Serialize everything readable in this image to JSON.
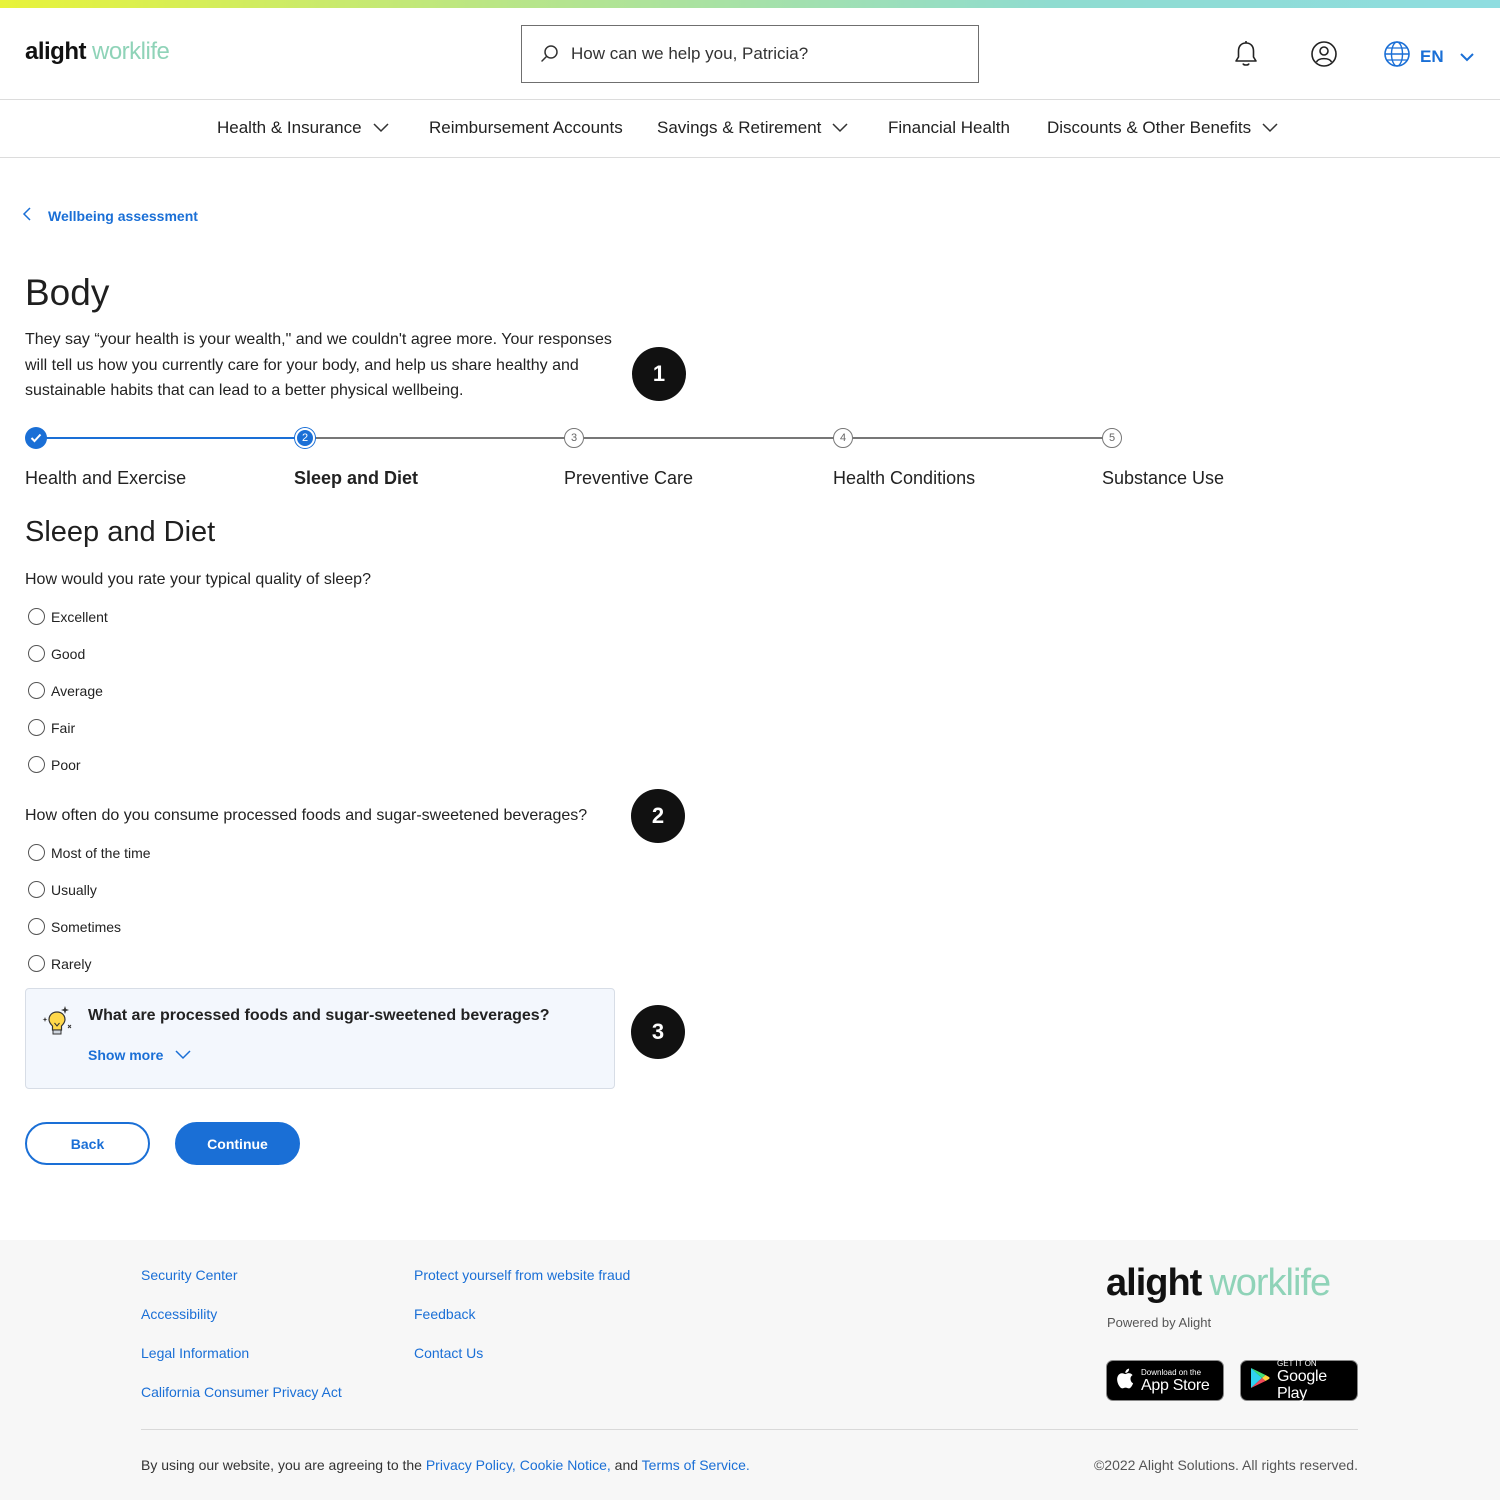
{
  "brand": {
    "logo_main": "alight",
    "logo_accent": "worklife"
  },
  "header": {
    "search_placeholder": "How can we help you, Patricia?",
    "language": "EN"
  },
  "nav": {
    "items": [
      {
        "label": "Health & Insurance",
        "has_dropdown": true
      },
      {
        "label": "Reimbursement Accounts",
        "has_dropdown": false
      },
      {
        "label": "Savings & Retirement",
        "has_dropdown": true
      },
      {
        "label": "Financial Health",
        "has_dropdown": false
      },
      {
        "label": "Discounts & Other Benefits",
        "has_dropdown": true
      }
    ]
  },
  "breadcrumb": {
    "back_label": "Wellbeing assessment"
  },
  "page": {
    "title": "Body",
    "intro": "They say “your health is your wealth,\" and we couldn't agree more. Your responses will tell us how you currently care for your body, and help us share healthy and sustainable habits that can lead to a better physical wellbeing."
  },
  "annotations": [
    "1",
    "2",
    "3"
  ],
  "stepper": {
    "current_step": 2,
    "steps": [
      {
        "number": "1",
        "label": "Health and Exercise",
        "state": "done"
      },
      {
        "number": "2",
        "label": "Sleep and Diet",
        "state": "current"
      },
      {
        "number": "3",
        "label": "Preventive Care",
        "state": "todo"
      },
      {
        "number": "4",
        "label": "Health Conditions",
        "state": "todo"
      },
      {
        "number": "5",
        "label": "Substance Use",
        "state": "todo"
      }
    ]
  },
  "section": {
    "title": "Sleep and Diet",
    "questions": [
      {
        "text": "How would you rate your typical quality of sleep?",
        "options": [
          "Excellent",
          "Good",
          "Average",
          "Fair",
          "Poor"
        ]
      },
      {
        "text": "How often do you consume processed foods and sugar-sweetened beverages?",
        "options": [
          "Most of the time",
          "Usually",
          "Sometimes",
          "Rarely"
        ]
      }
    ],
    "tip": {
      "title": "What are processed foods and sugar-sweetened beverages?",
      "toggle_label": "Show more"
    }
  },
  "actions": {
    "back_label": "Back",
    "continue_label": "Continue"
  },
  "footer": {
    "col1": [
      "Security Center",
      "Accessibility",
      "Legal Information",
      "California Consumer Privacy Act"
    ],
    "col2": [
      "Protect yourself from website fraud",
      "Feedback",
      "Contact Us"
    ],
    "powered_by": "Powered by Alight",
    "app_store": {
      "small": "Download on the",
      "big": "App Store"
    },
    "google_play": {
      "small": "GET IT ON",
      "big": "Google Play"
    },
    "legal_prefix": "By using our website, you are agreeing to the",
    "privacy_policy": "Privacy Policy,",
    "cookie_notice": "Cookie Notice,",
    "legal_and": "and",
    "terms": "Terms of Service.",
    "copyright": "©2022 Alight Solutions. All rights reserved."
  },
  "colors": {
    "accent": "#1a6fd6",
    "logo_accent": "#8fd3b8",
    "annotation": "#111111"
  }
}
